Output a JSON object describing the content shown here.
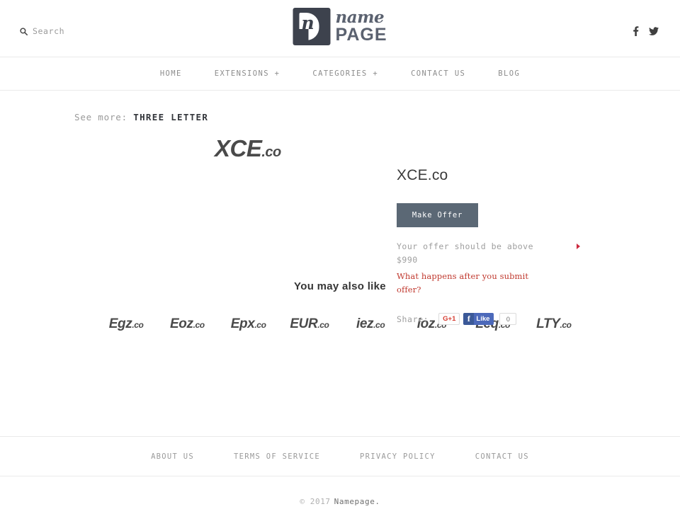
{
  "header": {
    "search_label": "Search",
    "search_icon": "search-icon",
    "logo": {
      "mark_letter": "n",
      "name": "name",
      "page": "PAGE"
    },
    "socials": [
      {
        "name": "facebook-icon",
        "label": "f"
      },
      {
        "name": "twitter-icon",
        "label": "t"
      }
    ]
  },
  "nav": {
    "items": [
      {
        "label": "HOME",
        "name": "nav-item-home"
      },
      {
        "label": "EXTENSIONS +",
        "name": "nav-item-extensions"
      },
      {
        "label": "CATEGORIES +",
        "name": "nav-item-categories"
      },
      {
        "label": "CONTACT US",
        "name": "nav-item-contact-us"
      },
      {
        "label": "BLOG",
        "name": "nav-item-blog"
      }
    ]
  },
  "seemore": {
    "prefix": "See more:",
    "link": "THREE LETTER"
  },
  "product": {
    "art_name": "XCE",
    "art_tld": ".co",
    "title": "XCE.co",
    "make_offer_label": "Make Offer",
    "offer_note": "Your offer should be above $990",
    "offer_minimum": "$990",
    "offer_help_link": "What happens after you submit offer?",
    "share_label": "Share:",
    "gplus_label": "G+1",
    "fb_f": "f",
    "fb_like_label": "Like",
    "fb_count": "0"
  },
  "alsolike": {
    "title": "You may also like",
    "items": [
      {
        "name": "Egz",
        "tld": ".co"
      },
      {
        "name": "Eoz",
        "tld": ".co"
      },
      {
        "name": "Epx",
        "tld": ".co"
      },
      {
        "name": "EUR",
        "tld": ".co"
      },
      {
        "name": "iez",
        "tld": ".co"
      },
      {
        "name": "ioz",
        "tld": ".co"
      },
      {
        "name": "Leq",
        "tld": ".co"
      },
      {
        "name": "LTY",
        "tld": ".co"
      }
    ]
  },
  "footer": {
    "links": [
      {
        "label": "ABOUT US",
        "name": "footer-link-about-us"
      },
      {
        "label": "TERMS OF SERVICE",
        "name": "footer-link-terms-of-service"
      },
      {
        "label": "PRIVACY POLICY",
        "name": "footer-link-privacy-policy"
      },
      {
        "label": "CONTACT US",
        "name": "footer-link-contact-us"
      }
    ],
    "copyright": "© 2017",
    "brand": "Namepage."
  },
  "colors": {
    "accent_red": "#c0392f",
    "button_slate": "#5b6875",
    "logo_slate": "#5b6270",
    "facebook_blue": "#4c69ba",
    "gplus_red": "#d73d32"
  }
}
